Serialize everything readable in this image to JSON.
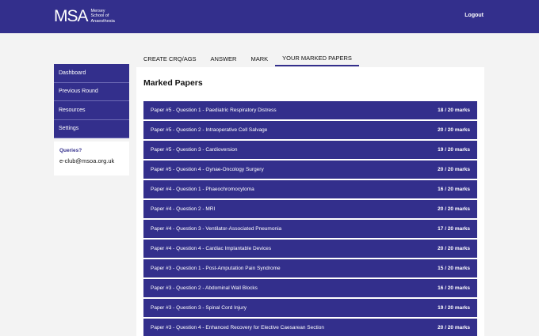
{
  "header": {
    "logo_mark": "MSA",
    "logo_line1": "Mersey",
    "logo_line2": "School of",
    "logo_line3": "Anaesthesia",
    "logout_label": "Logout"
  },
  "sidebar": {
    "items": [
      {
        "label": "Dashboard"
      },
      {
        "label": "Previous Round"
      },
      {
        "label": "Resources"
      },
      {
        "label": "Settings"
      }
    ],
    "queries_label": "Queries?",
    "queries_email": "e-club@msoa.org.uk"
  },
  "tabs": [
    {
      "label": "CREATE CRQ/AGS"
    },
    {
      "label": "ANSWER"
    },
    {
      "label": "MARK"
    },
    {
      "label": "YOUR MARKED PAPERS"
    }
  ],
  "main": {
    "title": "Marked Papers",
    "papers": [
      {
        "title": "Paper #5 - Question 1 - Paediatric Respiratory Distress",
        "marks": "18 / 20 marks"
      },
      {
        "title": "Paper #5 - Question 2 - Intraoperative Cell Salvage",
        "marks": "20 / 20 marks"
      },
      {
        "title": "Paper #5 - Question 3 - Cardioversion",
        "marks": "19 / 20 marks"
      },
      {
        "title": "Paper #5 - Question 4 - Gynae-Oncology Surgery",
        "marks": "20 / 20 marks"
      },
      {
        "title": "Paper #4 - Question 1 - Phaeochromocytoma",
        "marks": "16 / 20 marks"
      },
      {
        "title": "Paper #4 - Question 2 - MRI",
        "marks": "20 / 20 marks"
      },
      {
        "title": "Paper #4 - Question 3 - Ventilator-Associated Pneumonia",
        "marks": "17 / 20 marks"
      },
      {
        "title": "Paper #4 - Question 4 - Cardiac Implantable Devices",
        "marks": "20 / 20 marks"
      },
      {
        "title": "Paper #3 - Question 1 - Post-Amputation Pain Syndrome",
        "marks": "15 / 20 marks"
      },
      {
        "title": "Paper #3 - Question 2 - Abdominal Wall Blocks",
        "marks": "16 / 20 marks"
      },
      {
        "title": "Paper #3 - Question 3 - Spinal Cord Injury",
        "marks": "19 / 20 marks"
      },
      {
        "title": "Paper #3 - Question 4 - Enhanced Recovery for Elective Caesarean Section",
        "marks": "20 / 20 marks"
      }
    ]
  },
  "colors": {
    "brand": "#332f8c",
    "background": "#f3f3f3"
  }
}
